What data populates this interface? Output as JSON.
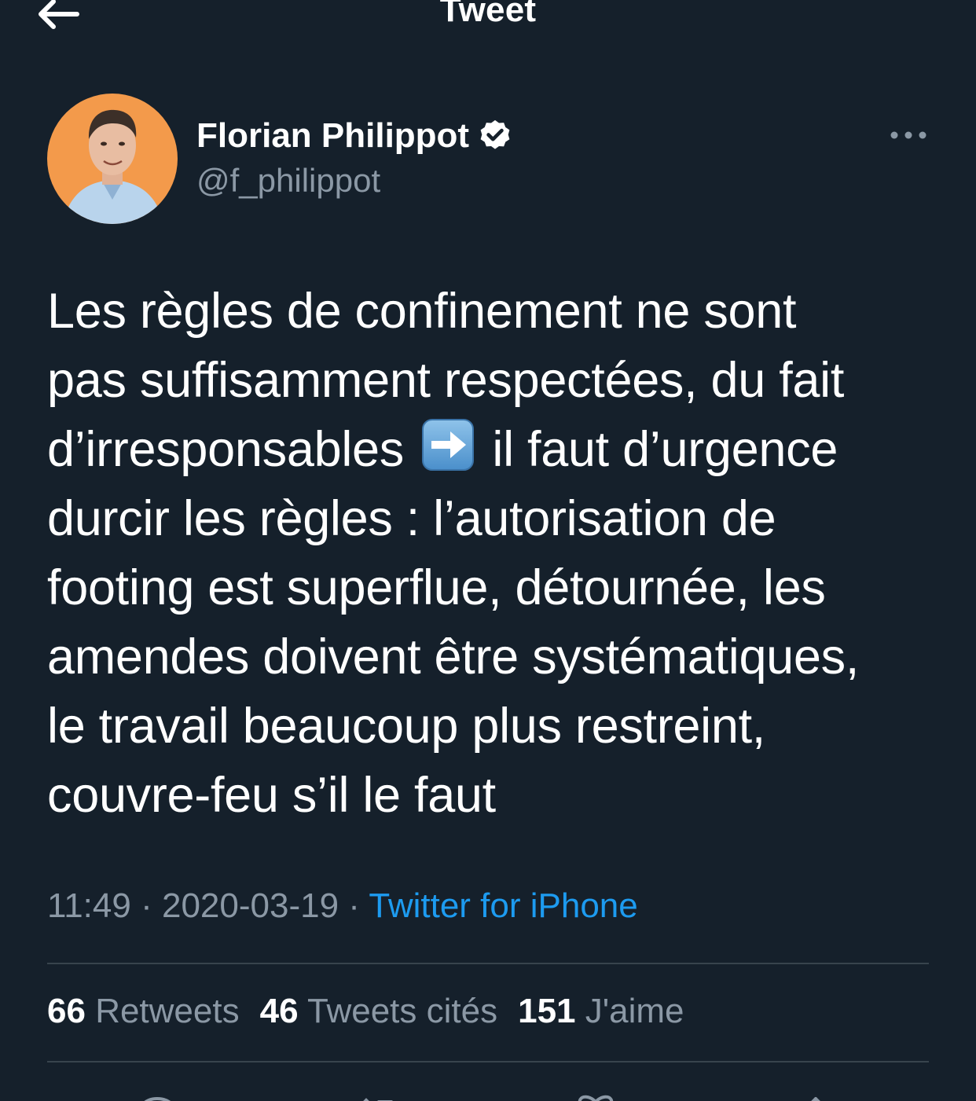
{
  "header": {
    "title": "Tweet",
    "back_icon": "arrow-left-icon"
  },
  "author": {
    "name": "Florian Philippot",
    "handle": "@f_philippot",
    "verified_icon": "verified-badge-icon",
    "avatar_bg": "#f39a4b"
  },
  "tweet": {
    "lines": [
      "Les règles de confinement ne sont",
      "pas suffisamment respectées, du fait",
      "d’irresponsables",
      "il faut d’urgence",
      "durcir les règles : l’autorisation de",
      "footing est superflue, détournée, les",
      "amendes doivent être systématiques,",
      "le travail beaucoup plus restreint,",
      "couvre-feu s’il le faut"
    ],
    "emoji": "right-arrow-emoji"
  },
  "meta": {
    "time": "11:49",
    "date": "2020-03-19",
    "separator": "·",
    "source": "Twitter for iPhone"
  },
  "stats": {
    "retweets_count": "66",
    "retweets_label": "Retweets",
    "quotes_count": "46",
    "quotes_label": "Tweets cités",
    "likes_count": "151",
    "likes_label": "J'aime"
  },
  "colors": {
    "background": "#15202b",
    "secondary_text": "#8b98a5",
    "link": "#1d9bf0",
    "divider": "#38444d"
  },
  "actions": [
    "reply-icon",
    "retweet-icon",
    "like-icon",
    "share-icon"
  ]
}
